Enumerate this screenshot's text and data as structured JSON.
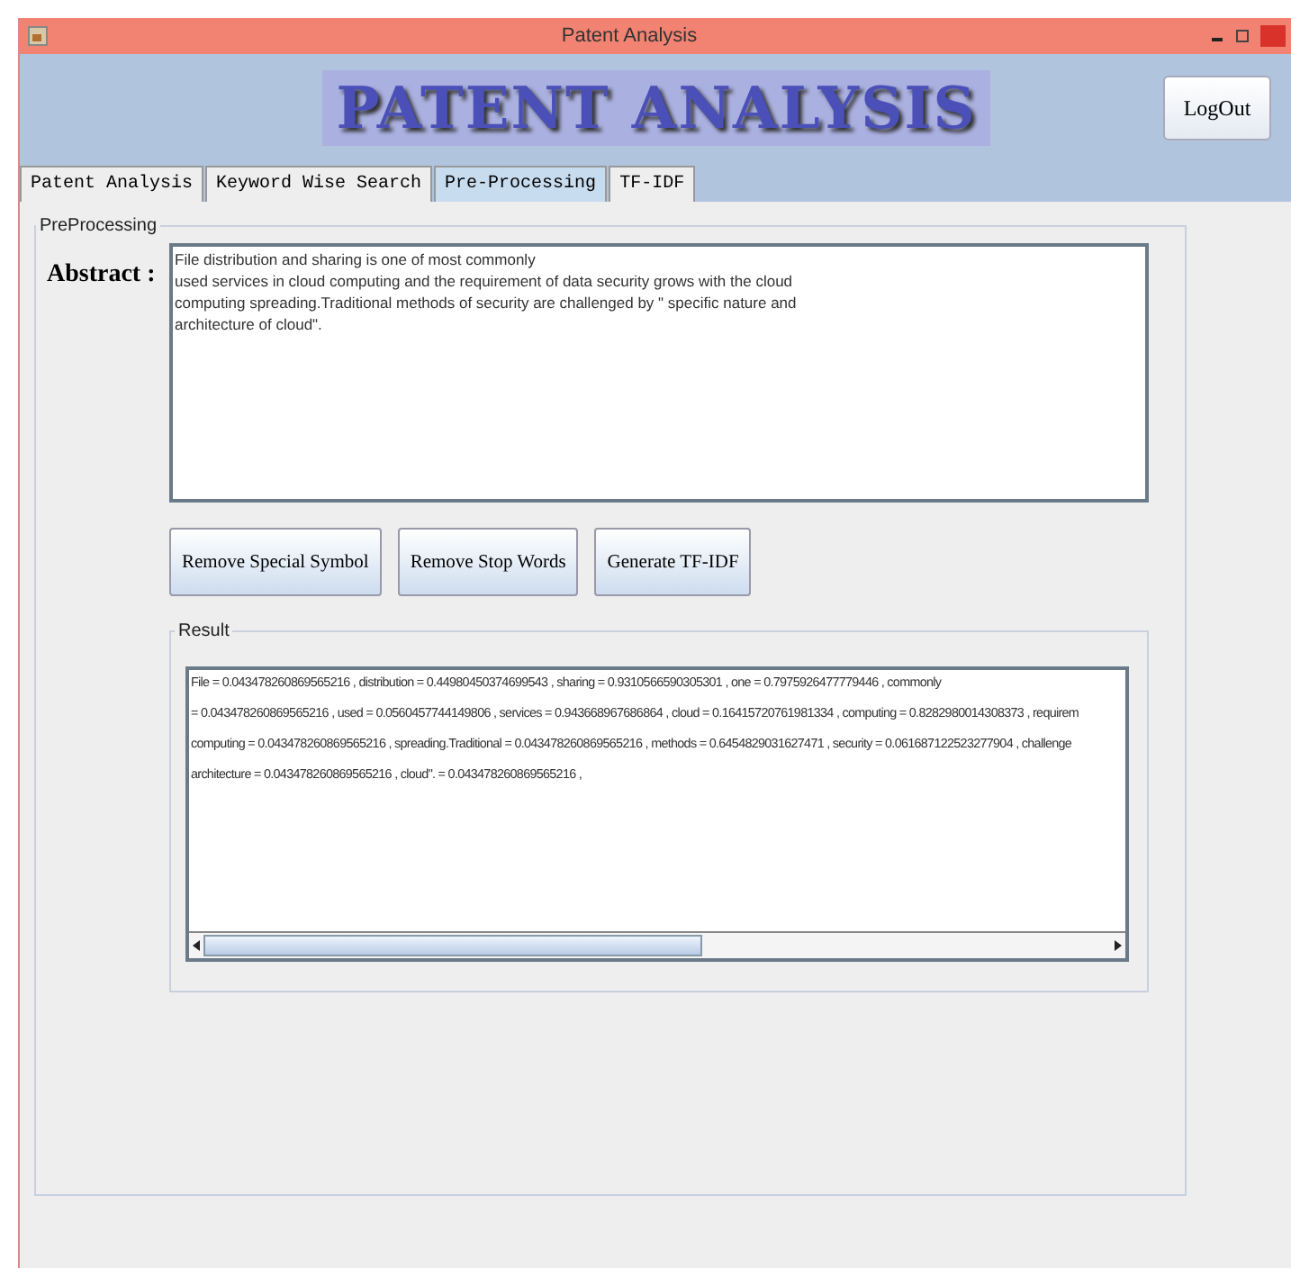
{
  "window": {
    "title": "Patent Analysis"
  },
  "header": {
    "banner": "PATENT ANALYSIS",
    "logout": "LogOut"
  },
  "tabs": [
    {
      "label": "Patent Analysis",
      "selected": false
    },
    {
      "label": "Keyword Wise Search",
      "selected": false
    },
    {
      "label": "Pre-Processing",
      "selected": true
    },
    {
      "label": "TF-IDF",
      "selected": false
    }
  ],
  "preprocessing": {
    "title": "PreProcessing",
    "abstract_label": "Abstract :",
    "abstract_lines": [
      "File distribution and sharing is one of most commonly",
      " used services in cloud computing and the requirement of data security grows with the cloud",
      "computing spreading.Traditional methods of security are challenged by \" specific nature and",
      "architecture of cloud\"."
    ],
    "buttons": [
      "Remove Special Symbol",
      "Remove Stop Words",
      "Generate TF-IDF"
    ],
    "result": {
      "title": "Result",
      "lines": [
        "File = 0.043478260869565216  , distribution = 0.44980450374699543  , sharing = 0.9310566590305301  , one = 0.7975926477779446  , commonly",
        " = 0.043478260869565216  , used = 0.0560457744149806  , services = 0.943668967686864  , cloud = 0.16415720761981334  , computing = 0.8282980014308373  , requirem",
        "computing = 0.043478260869565216  , spreading.Traditional = 0.043478260869565216  , methods = 0.6454829031627471  , security = 0.061687122523277904  , challenge",
        "architecture = 0.043478260869565216  , cloud\". = 0.043478260869565216  ,"
      ]
    }
  }
}
